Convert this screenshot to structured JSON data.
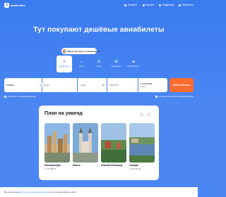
{
  "header": {
    "logo_text": "авиасейлс",
    "nav": [
      {
        "label": "Профиль",
        "icon": "user-icon"
      },
      {
        "label": "Корзина",
        "icon": "basket-icon"
      },
      {
        "label": "Поддержка",
        "icon": "support-icon"
      },
      {
        "label": "Избранное",
        "icon": "heart-icon"
      }
    ]
  },
  "hero": {
    "title": "Тут покупают дешёвые авиабилеты",
    "bus_pill": "Ищете автобус на Авиасейлс?"
  },
  "tabs": [
    {
      "label": "Авиабилеты",
      "icon": "plane-icon",
      "glyph": "✈",
      "active": true
    },
    {
      "label": "Отели",
      "icon": "hotel-icon",
      "glyph": "⌂",
      "active": false
    },
    {
      "label": "Поезд",
      "icon": "train-icon",
      "glyph": "⊟",
      "active": false
    },
    {
      "label": "Маршрутки",
      "icon": "bus-icon",
      "glyph": "⊞",
      "active": false
    },
    {
      "label": "Мой Маршрут",
      "icon": "route-icon",
      "glyph": "◈",
      "active": false
    }
  ],
  "search": {
    "from_value": "Москва",
    "to_placeholder": "Куда",
    "date_placeholder": "Когда",
    "return_placeholder": "Обратно",
    "pax_value": "1 пассажир",
    "pax_class": "эконом",
    "button_label": "Найти билеты",
    "compare_label": "Составить сложный маршрут",
    "booking_label": "Открыть Островок в новой вкладке"
  },
  "weekend": {
    "title": "План на уикенд",
    "cards": [
      {
        "city": "Екатеринбург",
        "price": "от 15 380 ₽"
      },
      {
        "city": "Минск",
        "price": ""
      },
      {
        "city": "Нижний Новгород",
        "price": ""
      },
      {
        "city": "Самара",
        "price": "от 15 013 ₽"
      }
    ]
  },
  "cookie": {
    "prefix": "Мы используем ",
    "link": "куки для персонализации сервисов",
    "suffix": " и улучшения работы сайта"
  },
  "colors": {
    "brand_blue": "#3a7bf0",
    "cta_orange": "#ff6d2e"
  }
}
